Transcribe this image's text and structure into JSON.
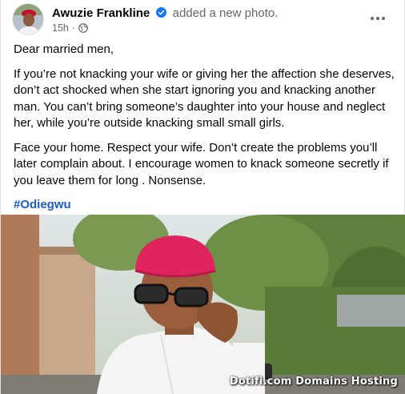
{
  "post": {
    "author": "Awuzie Frankline",
    "action": "added a new photo.",
    "time": "15h",
    "separator": "·",
    "privacy_icon": "globe-icon",
    "paragraphs": [
      "Dear married men,",
      "If you’re not knacking your wife or giving her the affection she deserves, don’t act shocked when she start ignoring you and knacking another man. You can’t bring someone’s daughter into your house and neglect her, while you’re outside knacking small small girls.",
      "Face your home. Respect your wife. Don’t create the problems you’ll later complain about. I encourage women to knack someone secretly if you leave them for long .  Nonsense."
    ],
    "hashtag": "#Odiegwu",
    "photo_watermark": "Dotifi.com Domains Hosting"
  },
  "colors": {
    "hashtag": "#1b5ec9",
    "verified": "#1877f2",
    "secondary_text": "#65676b",
    "cap": "#e0245e"
  }
}
